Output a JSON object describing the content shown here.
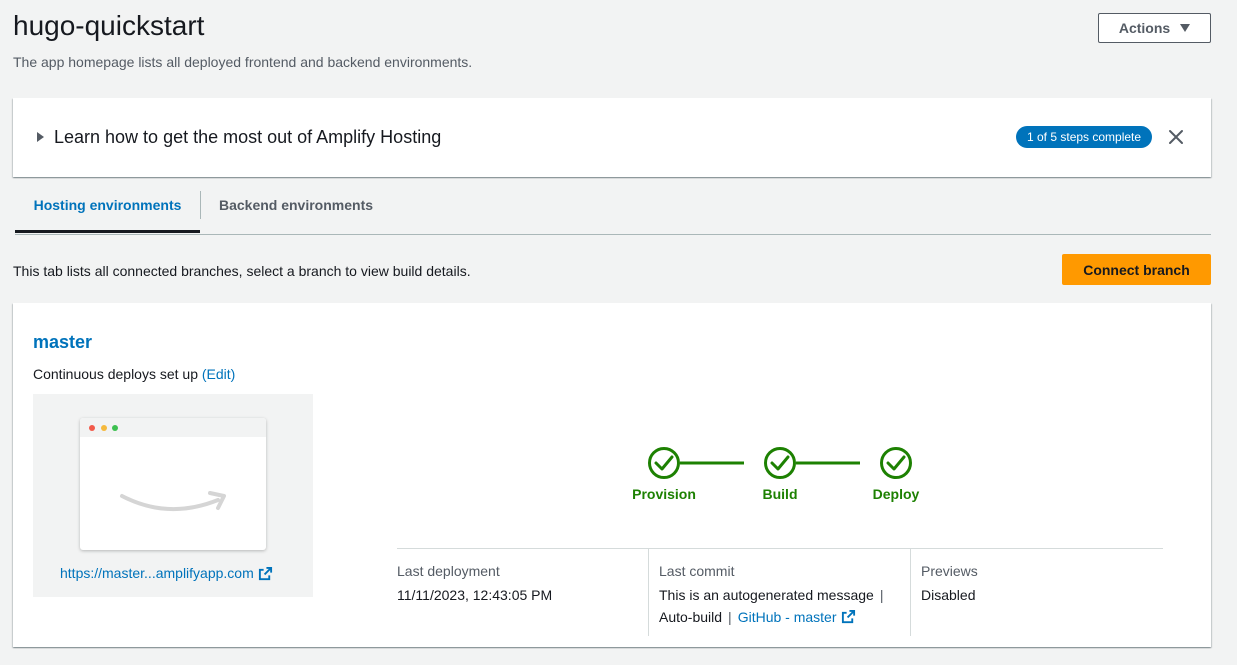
{
  "header": {
    "title": "hugo-quickstart",
    "description": "The app homepage lists all deployed frontend and backend environments.",
    "actions_label": "Actions"
  },
  "learn_panel": {
    "title": "Learn how to get the most out of Amplify Hosting",
    "badge": "1 of 5 steps complete"
  },
  "tabs": [
    {
      "label": "Hosting environments",
      "active": true
    },
    {
      "label": "Backend environments",
      "active": false
    }
  ],
  "tab_description": "This tab lists all connected branches, select a branch to view build details.",
  "connect_branch_label": "Connect branch",
  "branch": {
    "name": "master",
    "continuous_deploys": "Continuous deploys set up",
    "edit_label": "(Edit)",
    "preview_url": "https://master...amplifyapp.com",
    "steps": [
      {
        "label": "Provision",
        "status": "success"
      },
      {
        "label": "Build",
        "status": "success"
      },
      {
        "label": "Deploy",
        "status": "success"
      }
    ],
    "last_deployment": {
      "label": "Last deployment",
      "value": "11/11/2023, 12:43:05 PM"
    },
    "last_commit": {
      "label": "Last commit",
      "message": "This is an autogenerated message",
      "source": "Auto-build",
      "repo_link": "GitHub - master"
    },
    "previews": {
      "label": "Previews",
      "value": "Disabled"
    }
  },
  "colors": {
    "link": "#0073bb",
    "success": "#1d8102",
    "primary_button": "#ff9900",
    "badge": "#0073bb"
  }
}
